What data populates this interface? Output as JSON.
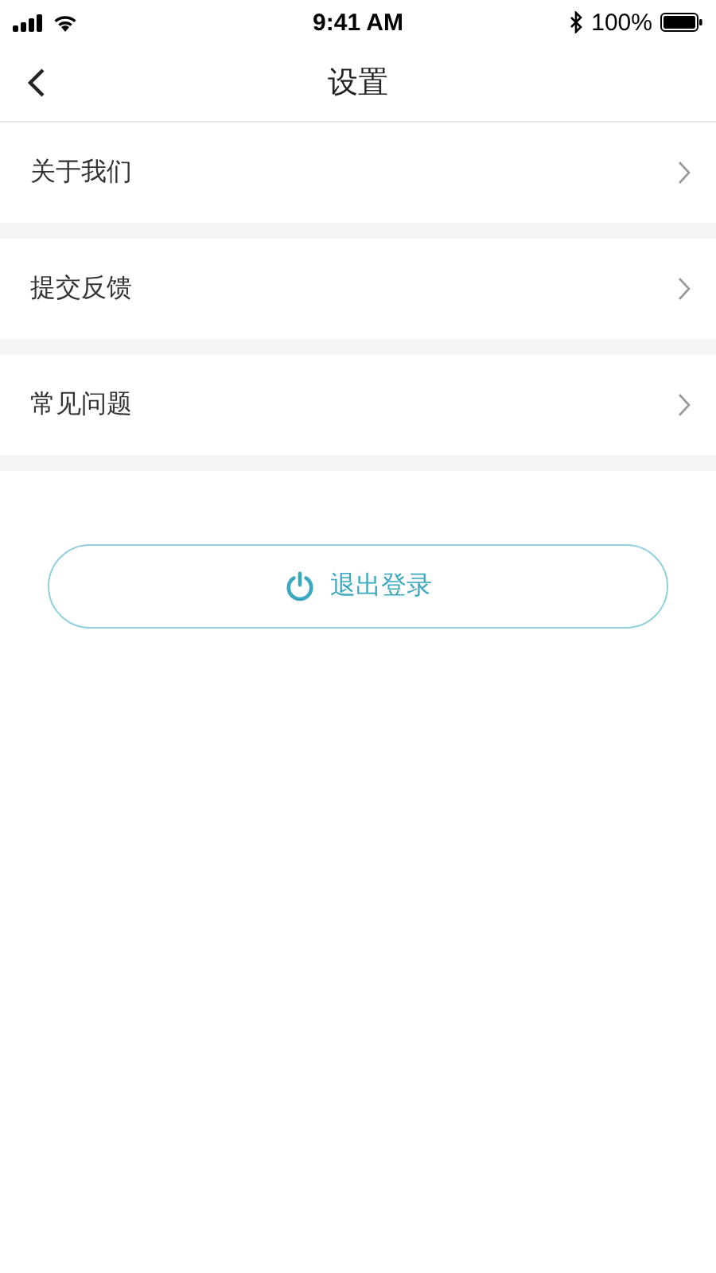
{
  "status_bar": {
    "time": "9:41 AM",
    "battery": "100%"
  },
  "nav": {
    "title": "设置"
  },
  "items": [
    {
      "label": "关于我们"
    },
    {
      "label": "提交反馈"
    },
    {
      "label": "常见问题"
    }
  ],
  "logout": {
    "label": "退出登录"
  }
}
